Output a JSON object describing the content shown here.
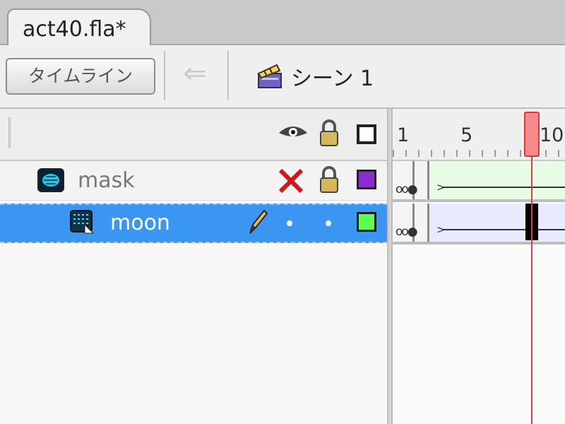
{
  "document_tab": {
    "label": "act40.fla*"
  },
  "toolbar": {
    "timeline_button": "タイムライン",
    "back_icon": "left-arrow-icon",
    "scene_icon": "clapperboard-icon",
    "scene_label": "シーン 1"
  },
  "layer_header": {
    "icons": [
      "eye-icon",
      "lock-icon",
      "outline-icon"
    ]
  },
  "layers": [
    {
      "name": "mask",
      "type_icon": "mask-layer-icon",
      "visibility": "hidden-x-icon",
      "locked": true,
      "outline_color": "#8b2bd1",
      "selected": false
    },
    {
      "name": "moon",
      "type_icon": "masked-layer-icon",
      "edit_icon": "pencil-icon",
      "locked": false,
      "outline_color": "#5cff4f",
      "selected": true
    }
  ],
  "timeline": {
    "ruler_labels": [
      "1",
      "5",
      "10"
    ],
    "current_frame_indicator": "playhead",
    "colors": {
      "playhead": "#e13b3b",
      "selection": "#3a96f0"
    }
  }
}
